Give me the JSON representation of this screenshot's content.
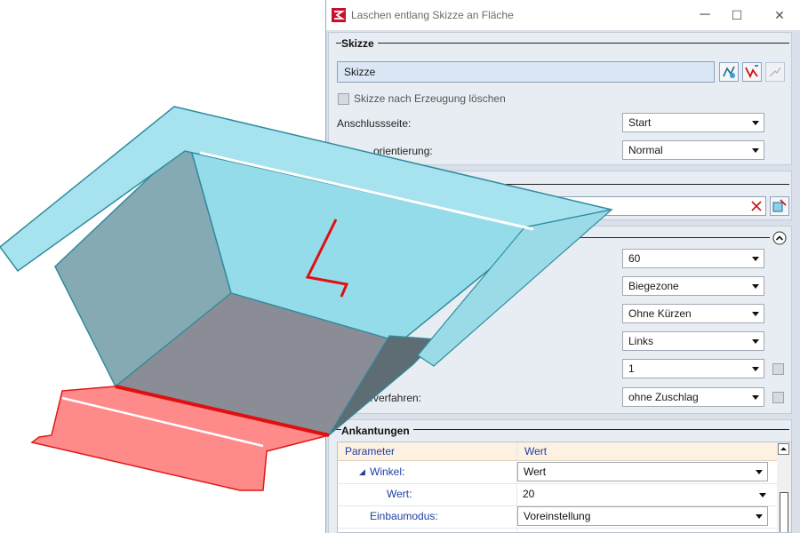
{
  "window": {
    "title": "Laschen entlang Skizze an Fläche",
    "minimize": "─",
    "maximize": "☐",
    "close": "✕"
  },
  "skizze": {
    "title": "Skizze",
    "field_value": "Skizze",
    "delete_checkbox_label": "Skizze nach Erzeugung löschen",
    "anschluss_label": "Anschlussseite:",
    "anschluss_value": "Start",
    "orient_label": "…orientierung:",
    "orient_value": "Normal"
  },
  "params": {
    "winkel_value": "60",
    "biege_value": "Biegezone",
    "kuerzen_value": "Ohne Kürzen",
    "seite_value": "Links",
    "anzahl_value": "1",
    "verfahren_label": "…verfahren:",
    "verfahren_value": "ohne Zuschlag"
  },
  "ankantungen": {
    "title": "Ankantungen",
    "col_param": "Parameter",
    "col_wert": "Wert",
    "rows": [
      {
        "param": "Winkel:",
        "value": "Wert",
        "expander": "◢"
      },
      {
        "param": "Wert:",
        "value": "20"
      },
      {
        "param": "Einbaumodus:",
        "value": "Voreinstellung"
      }
    ]
  },
  "colors": {
    "accent": "#1f3fa0",
    "model_blue": "#8fd8e8",
    "model_red": "#ff8080"
  },
  "icons": [
    "app-logo-icon",
    "sketch-select-icon",
    "sketch-edit-icon",
    "sketch-disabled-icon",
    "clear-icon",
    "face-select-icon",
    "collapse-icon"
  ]
}
